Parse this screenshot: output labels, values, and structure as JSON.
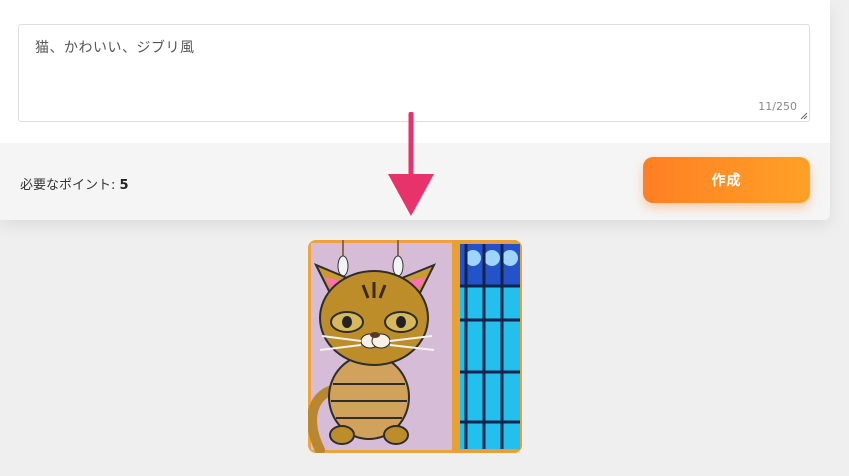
{
  "prompt": {
    "value": "猫、かわいい、ジブリ風",
    "char_count": "11/250"
  },
  "points": {
    "label": "必要なポイント: ",
    "value": "5"
  },
  "create_button": {
    "label": "作成"
  },
  "colors": {
    "accent_orange": "#ff8a24",
    "arrow_pink": "#e8326b",
    "panel_bg": "#f5f5f5",
    "page_bg": "#efefef"
  }
}
